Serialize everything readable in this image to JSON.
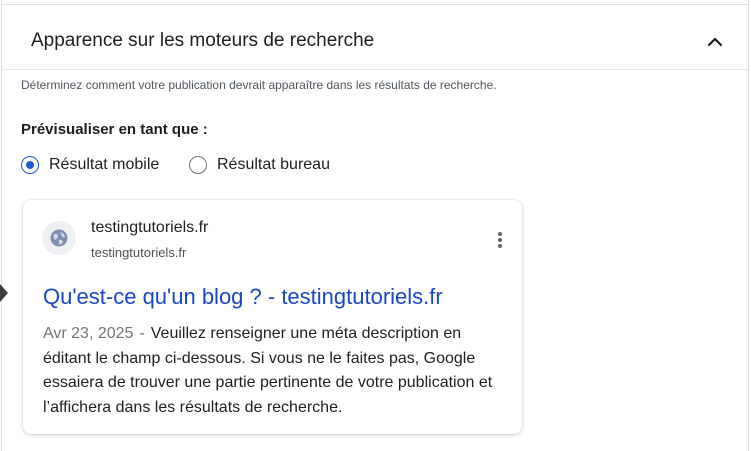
{
  "section": {
    "title": "Apparence sur les moteurs de recherche",
    "description": "Déterminez comment votre publication devrait apparaître dans les résultats de recherche."
  },
  "preview": {
    "label": "Prévisualiser en tant que :",
    "options": [
      {
        "label": "Résultat mobile",
        "checked": true
      },
      {
        "label": "Résultat bureau",
        "checked": false
      }
    ]
  },
  "result": {
    "site_name": "testingtutoriels.fr",
    "site_url": "testingtutoriels.fr",
    "title": "Qu'est-ce qu'un blog ? - testingtutoriels.fr",
    "date": "Avr 23, 2025",
    "separator": "-",
    "snippet": "Veuillez renseigner une méta description en éditant le champ ci-dessous. Si vous ne le faites pas, Google essaiera de trouver une partie pertinente de votre publication et l’affichera dans les résultats de recherche."
  },
  "colors": {
    "accent": "#1e5bd6",
    "link": "#1a48c4"
  },
  "icons": {
    "collapse": "chevron-up-icon",
    "favicon": "globe-icon",
    "more": "more-vertical-icon"
  }
}
